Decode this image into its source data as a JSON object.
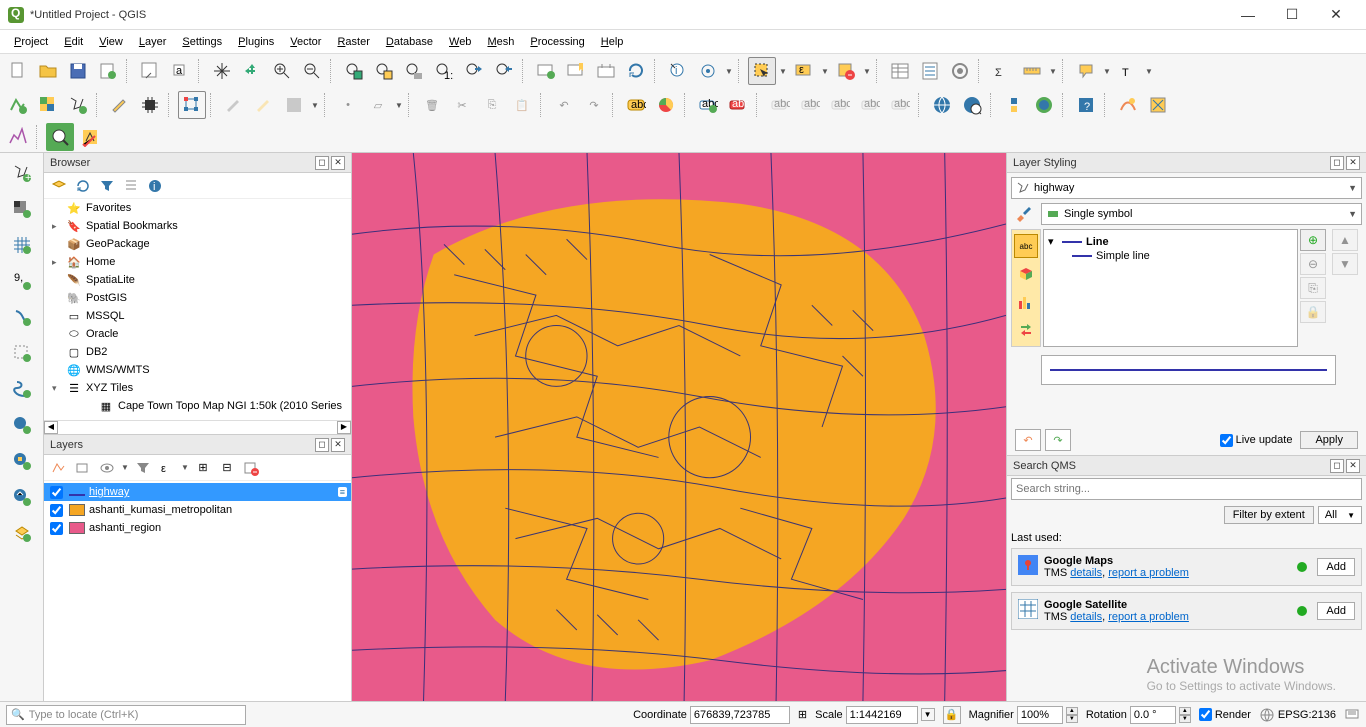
{
  "window": {
    "title": "*Untitled Project - QGIS"
  },
  "menus": [
    "Project",
    "Edit",
    "View",
    "Layer",
    "Settings",
    "Plugins",
    "Vector",
    "Raster",
    "Database",
    "Web",
    "Mesh",
    "Processing",
    "Help"
  ],
  "browser": {
    "title": "Browser",
    "items": [
      {
        "label": "Favorites",
        "icon": "star",
        "exp": ""
      },
      {
        "label": "Spatial Bookmarks",
        "icon": "bookmark",
        "exp": "▸"
      },
      {
        "label": "GeoPackage",
        "icon": "geopackage",
        "exp": ""
      },
      {
        "label": "Home",
        "icon": "home",
        "exp": "▸"
      },
      {
        "label": "SpatiaLite",
        "icon": "feather",
        "exp": ""
      },
      {
        "label": "PostGIS",
        "icon": "postgis",
        "exp": ""
      },
      {
        "label": "MSSQL",
        "icon": "mssql",
        "exp": ""
      },
      {
        "label": "Oracle",
        "icon": "oracle",
        "exp": ""
      },
      {
        "label": "DB2",
        "icon": "db2",
        "exp": ""
      },
      {
        "label": "WMS/WMTS",
        "icon": "wms",
        "exp": ""
      },
      {
        "label": "XYZ Tiles",
        "icon": "xyz",
        "exp": "▾"
      },
      {
        "label": "Cape Town Topo Map NGI 1:50k (2010 Series",
        "icon": "layer",
        "exp": "",
        "indent": true
      }
    ]
  },
  "layers": {
    "title": "Layers",
    "items": [
      {
        "name": "highway",
        "checked": true,
        "symbol": "line",
        "color": "#3333aa",
        "selected": true
      },
      {
        "name": "ashanti_kumasi_metropolitan",
        "checked": true,
        "symbol": "poly",
        "color": "#f5a623",
        "selected": false
      },
      {
        "name": "ashanti_region",
        "checked": true,
        "symbol": "poly",
        "color": "#e85a8a",
        "selected": false
      }
    ]
  },
  "styling": {
    "title": "Layer Styling",
    "layer_selector": "highway",
    "symbol_mode": "Single symbol",
    "tree": {
      "root": "Line",
      "child": "Simple line"
    },
    "live_update_label": "Live update",
    "live_update_checked": true,
    "apply_label": "Apply"
  },
  "qms": {
    "title": "Search QMS",
    "placeholder": "Search string...",
    "filter_extent": "Filter by extent",
    "filter_all": "All",
    "last_used_label": "Last used:",
    "cards": [
      {
        "name": "Google Maps",
        "type": "TMS",
        "details": "details",
        "report": "report a problem",
        "add": "Add"
      },
      {
        "name": "Google Satellite",
        "type": "TMS",
        "details": "details",
        "report": "report a problem",
        "add": "Add"
      }
    ]
  },
  "watermark": {
    "line1": "Activate Windows",
    "line2": "Go to Settings to activate Windows."
  },
  "status": {
    "locate_placeholder": "Type to locate (Ctrl+K)",
    "coordinate_label": "Coordinate",
    "coordinate_value": "676839,723785",
    "scale_label": "Scale",
    "scale_value": "1:1442169",
    "magnifier_label": "Magnifier",
    "magnifier_value": "100%",
    "rotation_label": "Rotation",
    "rotation_value": "0.0 °",
    "render_label": "Render",
    "render_checked": true,
    "crs": "EPSG:2136"
  }
}
